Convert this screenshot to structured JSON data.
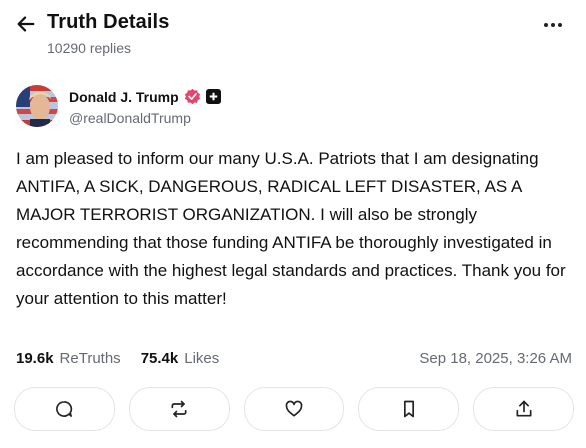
{
  "header": {
    "title": "Truth Details",
    "replies": "10290 replies"
  },
  "post": {
    "author_name": "Donald J. Trump",
    "handle": "@realDonaldTrump",
    "text": "I am pleased to inform our many U.S.A. Patriots that I am designating ANTIFA, A SICK, DANGEROUS, RADICAL LEFT DISASTER, AS A MAJOR TERRORIST ORGANIZATION. I will also be strongly recommending that those funding ANTIFA be thoroughly investigated in accordance with the highest legal standards and practices. Thank you for your attention to this matter!",
    "retruths_count": "19.6k",
    "retruths_label": "ReTruths",
    "likes_count": "75.4k",
    "likes_label": "Likes",
    "timestamp": "Sep 18, 2025, 3:26 AM"
  },
  "icons": {
    "back": "arrow-left-icon",
    "more": "more-dots-icon",
    "verified": "verified-badge-icon",
    "plus": "plus-badge-icon",
    "reply": "reply-icon",
    "retruth": "retruth-icon",
    "like": "heart-icon",
    "bookmark": "bookmark-icon",
    "share": "share-icon"
  },
  "colors": {
    "verified": "#e8436b",
    "muted_text": "#666a73",
    "border": "#e3e5e9"
  }
}
